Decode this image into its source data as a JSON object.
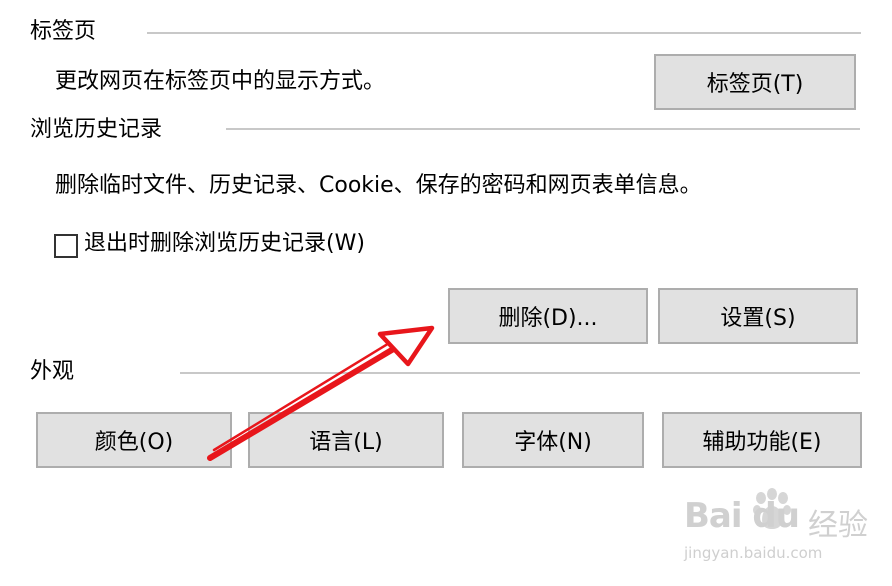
{
  "tabs_section": {
    "title": "标签页",
    "description": "更改网页在标签页中的显示方式。",
    "button_label": "标签页(T)"
  },
  "history_section": {
    "title": "浏览历史记录",
    "description": "删除临时文件、历史记录、Cookie、保存的密码和网页表单信息。",
    "checkbox_label": "退出时删除浏览历史记录(W)",
    "checkbox_checked": false,
    "delete_button": "删除(D)...",
    "settings_button": "设置(S)"
  },
  "appearance_section": {
    "title": "外观",
    "colors_button": "颜色(O)",
    "languages_button": "语言(L)",
    "fonts_button": "字体(N)",
    "accessibility_button": "辅助功能(E)"
  },
  "annotation": {
    "arrow_color": "#e8161b"
  },
  "watermark": {
    "brand": "Bai du",
    "suffix": "经验",
    "url": "jingyan.baidu.com"
  }
}
